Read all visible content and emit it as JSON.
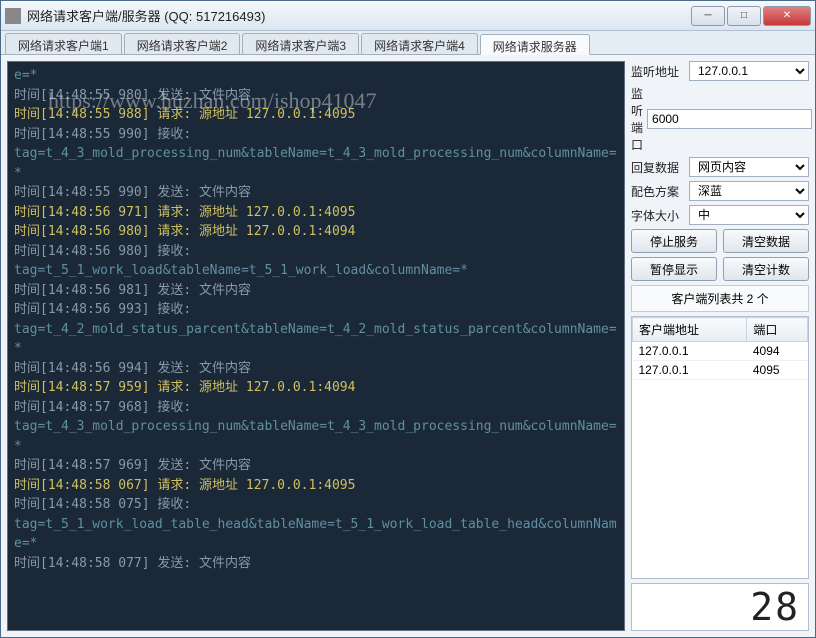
{
  "window": {
    "title": "网络请求客户端/服务器 (QQ: 517216493)"
  },
  "watermark": "https://www.huzhan.com/ishop41047",
  "tabs": [
    {
      "label": "网络请求客户端1",
      "active": false
    },
    {
      "label": "网络请求客户端2",
      "active": false
    },
    {
      "label": "网络请求客户端3",
      "active": false
    },
    {
      "label": "网络请求客户端4",
      "active": false
    },
    {
      "label": "网络请求服务器",
      "active": true
    }
  ],
  "log": [
    {
      "cls": "t-data",
      "text": "e=*"
    },
    {
      "cls": "t-send",
      "text": "时间[14:48:55 980] 发送: 文件内容"
    },
    {
      "cls": "t-req",
      "text": "时间[14:48:55 988] 请求: 源地址 127.0.0.1:4095"
    },
    {
      "cls": "t-recv",
      "text": "时间[14:48:55 990] 接收:"
    },
    {
      "cls": "t-data",
      "text": "tag=t_4_3_mold_processing_num&tableName=t_4_3_mold_processing_num&columnName=*"
    },
    {
      "cls": "t-send",
      "text": "时间[14:48:55 990] 发送: 文件内容"
    },
    {
      "cls": "t-req",
      "text": "时间[14:48:56 971] 请求: 源地址 127.0.0.1:4095"
    },
    {
      "cls": "t-req",
      "text": "时间[14:48:56 980] 请求: 源地址 127.0.0.1:4094"
    },
    {
      "cls": "t-recv",
      "text": "时间[14:48:56 980] 接收:"
    },
    {
      "cls": "t-data",
      "text": "tag=t_5_1_work_load&tableName=t_5_1_work_load&columnName=*"
    },
    {
      "cls": "t-send",
      "text": "时间[14:48:56 981] 发送: 文件内容"
    },
    {
      "cls": "t-recv",
      "text": "时间[14:48:56 993] 接收:"
    },
    {
      "cls": "t-data",
      "text": "tag=t_4_2_mold_status_parcent&tableName=t_4_2_mold_status_parcent&columnName=*"
    },
    {
      "cls": "t-send",
      "text": "时间[14:48:56 994] 发送: 文件内容"
    },
    {
      "cls": "t-req",
      "text": "时间[14:48:57 959] 请求: 源地址 127.0.0.1:4094"
    },
    {
      "cls": "t-recv",
      "text": "时间[14:48:57 968] 接收:"
    },
    {
      "cls": "t-data",
      "text": "tag=t_4_3_mold_processing_num&tableName=t_4_3_mold_processing_num&columnName=*"
    },
    {
      "cls": "t-send",
      "text": "时间[14:48:57 969] 发送: 文件内容"
    },
    {
      "cls": "t-req",
      "text": "时间[14:48:58 067] 请求: 源地址 127.0.0.1:4095"
    },
    {
      "cls": "t-recv",
      "text": "时间[14:48:58 075] 接收:"
    },
    {
      "cls": "t-data",
      "text": "tag=t_5_1_work_load_table_head&tableName=t_5_1_work_load_table_head&columnName=*"
    },
    {
      "cls": "t-send",
      "text": "时间[14:48:58 077] 发送: 文件内容"
    }
  ],
  "side": {
    "listen_addr_label": "监听地址",
    "listen_addr_value": "127.0.0.1",
    "listen_port_label": "监听端口",
    "listen_port_value": "6000",
    "reply_data_label": "回复数据",
    "reply_data_value": "网页内容",
    "color_scheme_label": "配色方案",
    "color_scheme_value": "深蓝",
    "font_size_label": "字体大小",
    "font_size_value": "中",
    "btn_stop": "停止服务",
    "btn_clear_data": "清空数据",
    "btn_pause": "暂停显示",
    "btn_clear_count": "清空计数",
    "client_count_text": "客户端列表共 2 个",
    "table_head_addr": "客户端地址",
    "table_head_port": "端口",
    "clients": [
      {
        "addr": "127.0.0.1",
        "port": "4094"
      },
      {
        "addr": "127.0.0.1",
        "port": "4095"
      }
    ],
    "counter": "28"
  }
}
